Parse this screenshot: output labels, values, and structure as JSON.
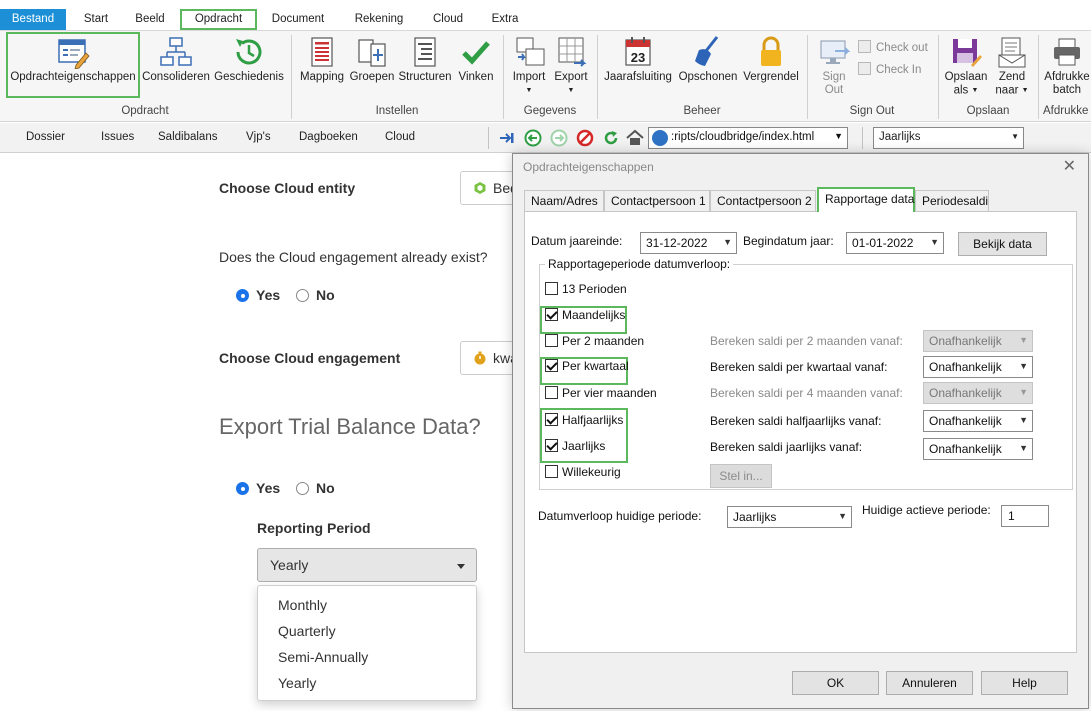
{
  "ribbon_tabs": [
    "Bestand",
    "Start",
    "Beeld",
    "Opdracht",
    "Document",
    "Rekening",
    "Cloud",
    "Extra"
  ],
  "ribbon": {
    "opdracht": {
      "buttons": [
        "Opdrachteigenschappen",
        "Consolideren",
        "Geschiedenis"
      ],
      "group_label": "Opdracht"
    },
    "instellen": {
      "buttons": [
        "Mapping",
        "Groepen",
        "Structuren",
        "Vinken"
      ],
      "group_label": "Instellen"
    },
    "gegevens": {
      "buttons": [
        "Import",
        "Export"
      ],
      "group_label": "Gegevens"
    },
    "beheer": {
      "buttons": [
        "Jaarafsluiting",
        "Opschonen",
        "Vergrendel"
      ],
      "group_label": "Beheer",
      "calendar_day": "23"
    },
    "signout": {
      "sign_out_line1": "Sign",
      "sign_out_line2": "Out",
      "check_out": "Check out",
      "check_in": "Check In",
      "group_label": "Sign Out"
    },
    "opslaan": {
      "opslaan_line1": "Opslaan",
      "opslaan_line2": "als",
      "zend_line1": "Zend",
      "zend_line2": "naar",
      "group_label": "Opslaan"
    },
    "afdrukken": {
      "line1": "Afdrukke",
      "line2": "batch",
      "group_label": "Afdrukke"
    }
  },
  "nav_tabs": [
    "Dossier",
    "Issues",
    "Saldibalans",
    "Vjp's",
    "Dagboeken",
    "Cloud"
  ],
  "address": ":ripts/cloudbridge/index.html",
  "period_select": "Jaarlijks",
  "web": {
    "choose_entity_label": "Choose Cloud entity",
    "entity_button": "Bed",
    "engagement_exists_question": "Does the Cloud engagement already exist?",
    "yes": "Yes",
    "no": "No",
    "choose_engagement_label": "Choose Cloud engagement",
    "engagement_button": "kwa",
    "export_heading": "Export Trial Balance Data?",
    "reporting_period_label": "Reporting Period",
    "reporting_period_value": "Yearly",
    "reporting_period_options": [
      "Monthly",
      "Quarterly",
      "Semi-Annually",
      "Yearly"
    ]
  },
  "dialog": {
    "title": "Opdrachteigenschappen",
    "tabs": [
      "Naam/Adres",
      "Contactpersoon 1",
      "Contactpersoon 2",
      "Rapportage data",
      "Periodesaldi"
    ],
    "active_tab": "Rapportage data",
    "datum_jaareinde_label": "Datum jaareinde:",
    "datum_jaareinde_value": "31-12-2022",
    "begindatum_label": "Begindatum jaar:",
    "begindatum_value": "01-01-2022",
    "bekijk_data": "Bekijk data",
    "group_title": "Rapportageperiode datumverloop:",
    "periods": [
      {
        "label": "13 Perioden",
        "checked": false
      },
      {
        "label": "Maandelijks",
        "checked": true
      },
      {
        "label": "Per 2 maanden",
        "checked": false
      },
      {
        "label": "Per kwartaal",
        "checked": true
      },
      {
        "label": "Per vier maanden",
        "checked": false
      },
      {
        "label": "Halfjaarlijks",
        "checked": true
      },
      {
        "label": "Jaarlijks",
        "checked": true
      },
      {
        "label": "Willekeurig",
        "checked": false
      }
    ],
    "bereken": [
      {
        "label": "Bereken saldi per 2 maanden vanaf:",
        "value": "Onafhankelijk",
        "enabled": false
      },
      {
        "label": "Bereken saldi per kwartaal vanaf:",
        "value": "Onafhankelijk",
        "enabled": true
      },
      {
        "label": "Bereken saldi per 4 maanden vanaf:",
        "value": "Onafhankelijk",
        "enabled": false
      },
      {
        "label": "Bereken saldi halfjaarlijks vanaf:",
        "value": "Onafhankelijk",
        "enabled": true
      },
      {
        "label": "Bereken saldi jaarlijks vanaf:",
        "value": "Onafhankelijk",
        "enabled": true
      }
    ],
    "stel_in": "Stel in...",
    "datumverloop_label": "Datumverloop huidige periode:",
    "datumverloop_value": "Jaarlijks",
    "actieve_periode_label": "Huidige actieve periode:",
    "actieve_periode_value": "1",
    "ok": "OK",
    "annuleren": "Annuleren",
    "help": "Help"
  },
  "colors": {
    "file_tab": "#1c8fd6",
    "highlight_green": "#5cb85c",
    "radio_blue": "#1a73e8"
  }
}
